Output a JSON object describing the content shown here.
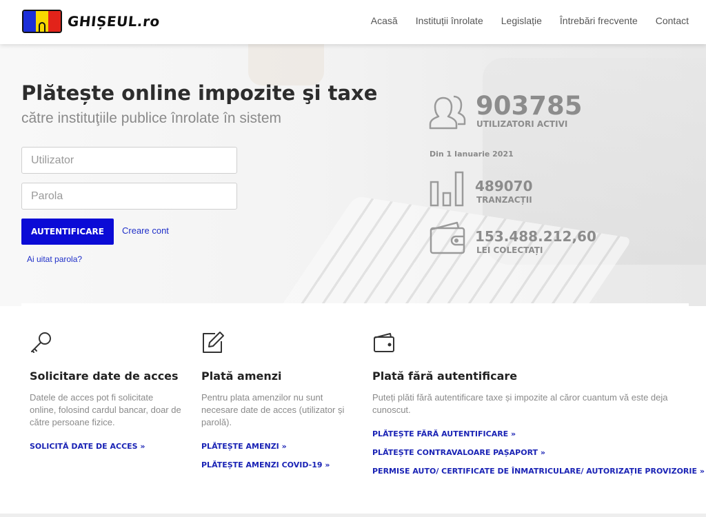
{
  "header": {
    "brand": "GHIȘEUL.ro",
    "nav": [
      "Acasă",
      "Instituții înrolate",
      "Legislație",
      "Întrebări frecvente",
      "Contact"
    ]
  },
  "hero": {
    "title": "Plătește online impozite şi taxe",
    "subtitle": "către instituţiile publice înrolate în sistem",
    "username_placeholder": "Utilizator",
    "password_placeholder": "Parola",
    "login_label": "AUTENTIFICARE",
    "create_account": "Creare cont",
    "forgot_password": "Ai uitat parola?"
  },
  "stats": {
    "users_value": "903785",
    "users_label": "UTILIZATORI ACTIVI",
    "since": "Din 1 Ianuarie 2021",
    "transactions_value": "489070",
    "transactions_label": "TRANZACȚII",
    "collected_value": "153.488.212,60",
    "collected_label": "LEI COLECTAȚI"
  },
  "cards": [
    {
      "title": "Solicitare date de acces",
      "text": "Datele de acces pot fi solicitate online, folosind cardul bancar, doar de către persoane fizice.",
      "links": [
        "SOLICITĂ DATE DE ACCES »"
      ]
    },
    {
      "title": "Plată amenzi",
      "text": "Pentru plata amenzilor nu sunt necesare date de acces (utilizator și parolă).",
      "links": [
        "PLĂTEȘTE AMENZI »",
        "PLĂTEȘTE AMENZI COVID-19 »"
      ]
    },
    {
      "title": "Plată fără autentificare",
      "text": "Puteți plăti fără autentificare taxe și impozite al căror cuantum vă este deja cunoscut.",
      "links": [
        "PLĂTEȘTE FĂRĂ AUTENTIFICARE »",
        "PLĂTEȘTE CONTRAVALOARE PAȘAPORT »",
        "PERMISE AUTO/ CERTIFICATE DE ÎNMATRICULARE/ AUTORIZAȚIE PROVIZORIE »"
      ]
    }
  ],
  "colors": {
    "primary_button": "#0b0bd6",
    "link": "#1a23b5",
    "stat_gray": "#8c8c8c"
  }
}
